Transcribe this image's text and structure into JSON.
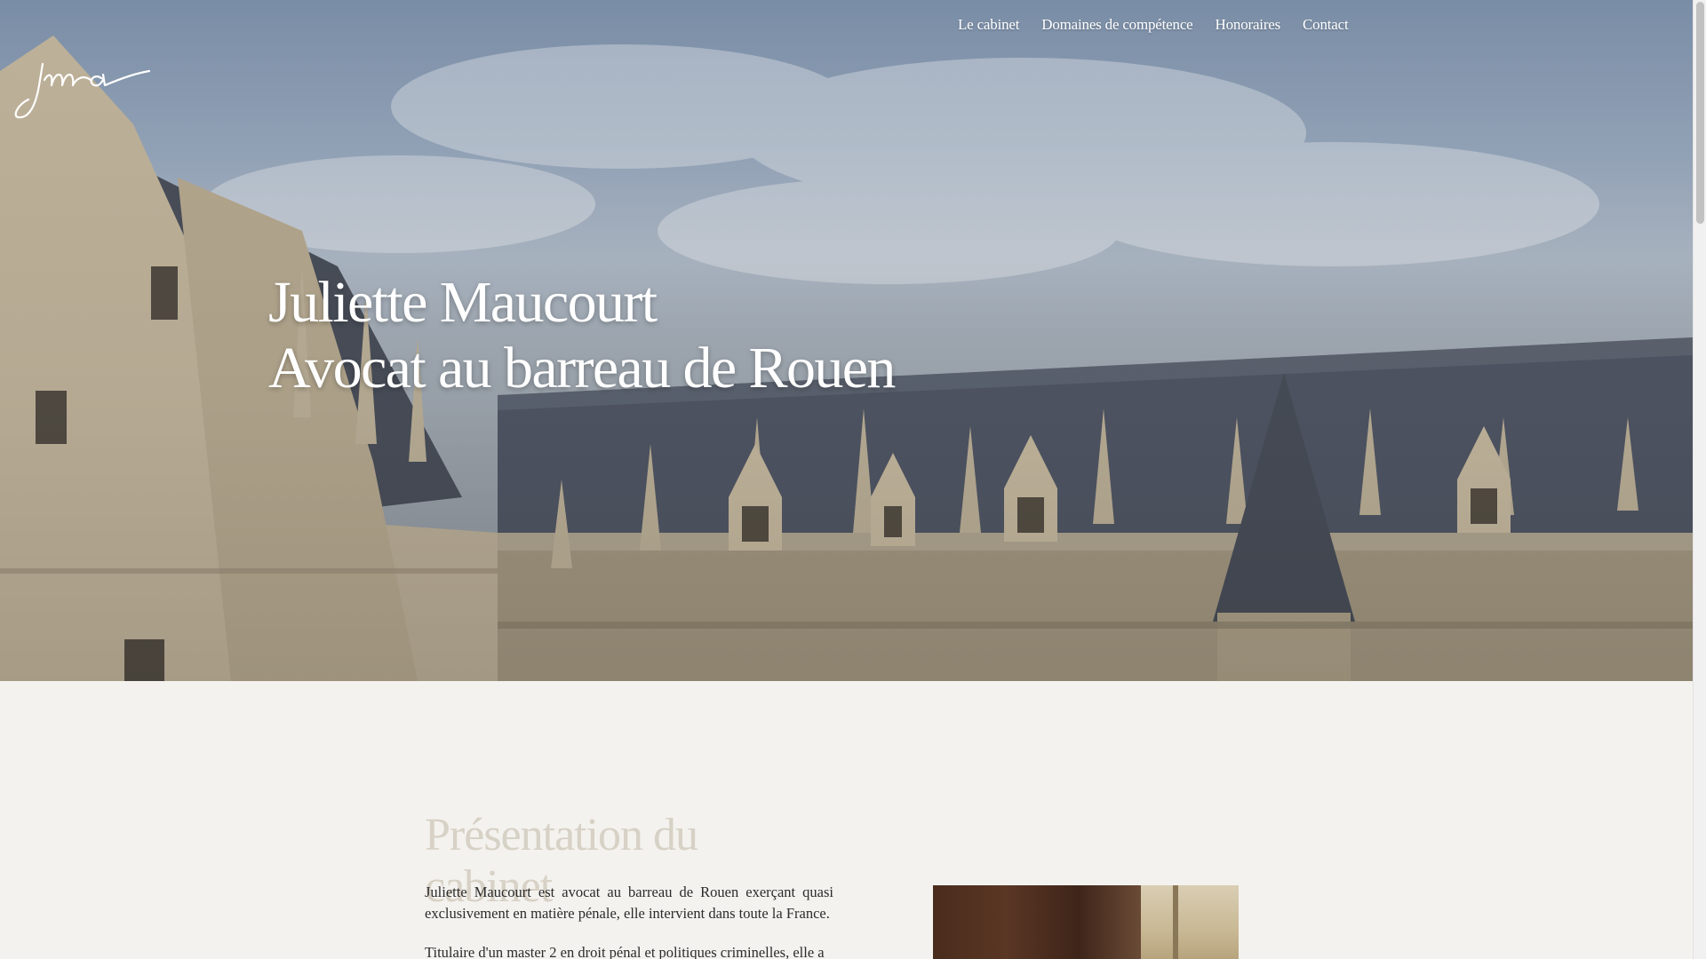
{
  "brand": {
    "logo_icon": "jma-signature-logo-icon"
  },
  "nav": {
    "items": [
      {
        "label": "Le cabinet"
      },
      {
        "label": "Domaines de compétence"
      },
      {
        "label": "Honoraires"
      },
      {
        "label": "Contact"
      }
    ]
  },
  "hero": {
    "title_line1": "Juliette Maucourt",
    "title_line2": "Avocat au barreau de Rouen",
    "background_icon": "gothic-palace-photo-icon"
  },
  "presentation": {
    "heading": "Présentation du cabinet",
    "paragraph1": "Juliette Maucourt est avocat au barreau de Rouen exerçant quasi exclusivement en matière pénale, elle intervient dans toute la France.",
    "paragraph2": "Titulaire d'un master 2 en droit pénal et politiques criminelles, elle a",
    "portrait_icon": "lawyer-portrait-photo-icon"
  },
  "colors": {
    "page_background": "#f4f2ee",
    "heading_muted": "#d7d1c6",
    "hero_text": "#ffffff"
  }
}
